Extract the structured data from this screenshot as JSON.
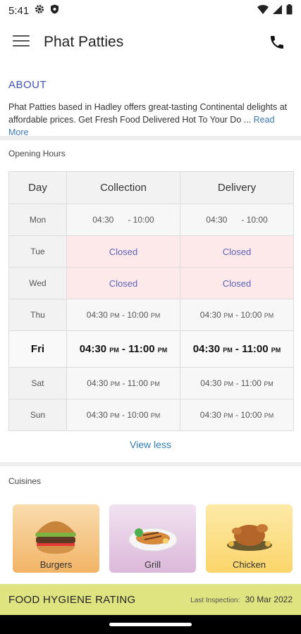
{
  "status_bar": {
    "time": "5:41"
  },
  "app_bar": {
    "title": "Phat Patties",
    "menu_icon": "menu-icon",
    "phone_icon": "phone-icon"
  },
  "about": {
    "title": "ABOUT",
    "text": "Phat Patties based in Hadley offers great-tasting Continental delights at affordable prices. Get Fresh Food Delivered Hot To Your Do ...",
    "read_more": "Read More"
  },
  "opening_hours": {
    "label": "Opening Hours",
    "headers": [
      "Day",
      "Collection",
      "Delivery"
    ],
    "rows": [
      {
        "day": "Mon",
        "collection": "04:30      - 10:00",
        "delivery": "04:30      - 10:00"
      },
      {
        "day": "Tue",
        "collection": "Closed",
        "delivery": "Closed"
      },
      {
        "day": "Wed",
        "collection": "Closed",
        "delivery": "Closed"
      },
      {
        "day": "Thu",
        "collection": "04:30 PM - 10:00 PM",
        "delivery": "04:30 PM - 10:00 PM"
      },
      {
        "day": "Fri",
        "collection": "04:30 PM - 11:00 PM",
        "delivery": "04:30 PM - 11:00 PM"
      },
      {
        "day": "Sat",
        "collection": "04:30 PM - 11:00 PM",
        "delivery": "04:30 PM - 11:00 PM"
      },
      {
        "day": "Sun",
        "collection": "04:30 PM - 10:00 PM",
        "delivery": "04:30 PM - 10:00 PM"
      }
    ],
    "view_less": "View less"
  },
  "cuisines": {
    "label": "Cuisines",
    "items": [
      {
        "name": "Burgers",
        "color": "#f5c98a"
      },
      {
        "name": "Grill",
        "color": "#e7cfe6"
      },
      {
        "name": "Chicken",
        "color": "#fde08c"
      }
    ]
  },
  "hygiene": {
    "title": "FOOD HYGIENE RATING",
    "inspection_label": "Last Inspection:",
    "inspection_date": "30 Mar 2022"
  },
  "colors": {
    "accent": "#3f51b5",
    "link": "#2f7ab4",
    "closed_bg": "#fde9ea",
    "hygiene_bg": "#dfe380"
  }
}
